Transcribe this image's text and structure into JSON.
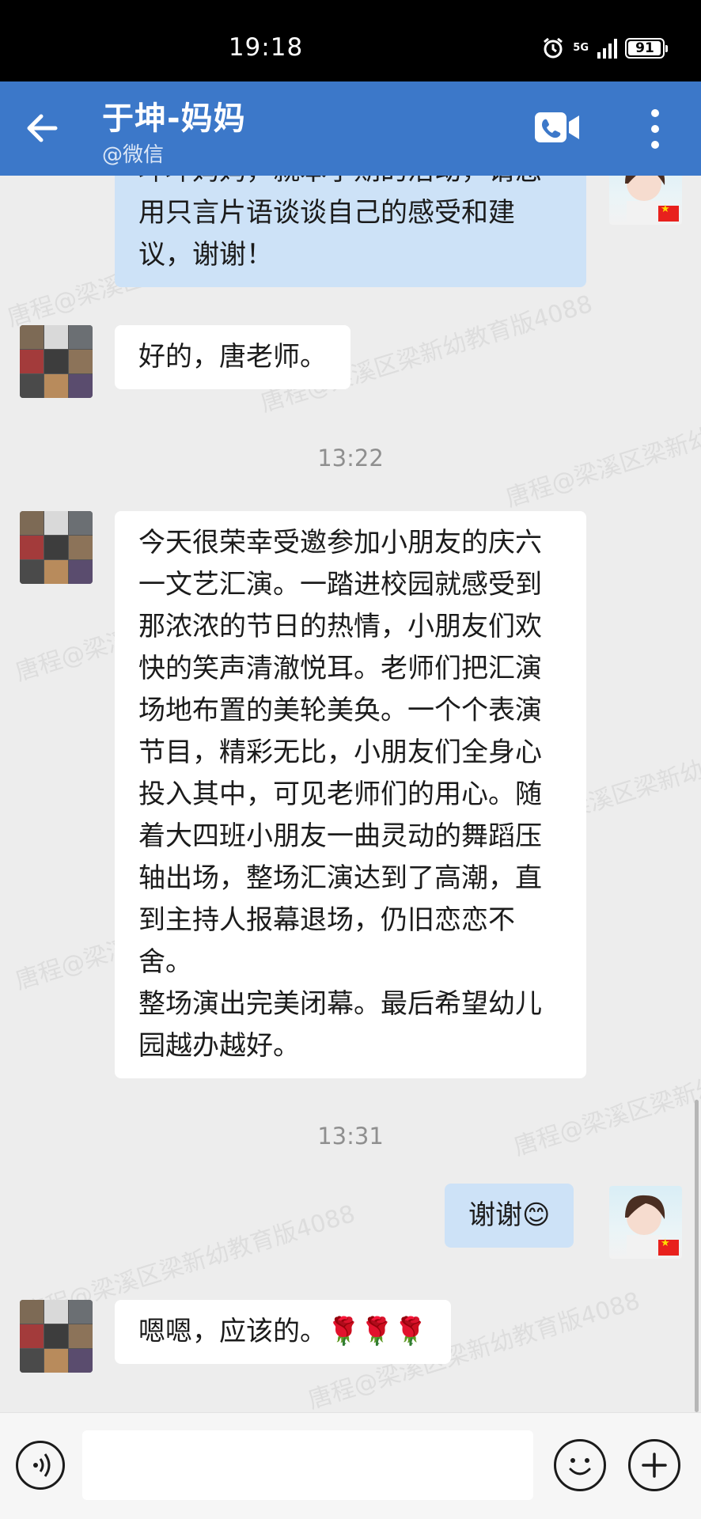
{
  "status_bar": {
    "time": "19:18",
    "network": "5G",
    "battery": "91"
  },
  "header": {
    "title": "于坤-妈妈",
    "subtitle": "@微信"
  },
  "watermark_text": "唐程@梁溪区梁新幼教育版4088",
  "messages": [
    {
      "sender": "self",
      "text": "坤坤妈妈，就本学期的活动，请您用只言片语谈谈自己的感受和建议，谢谢！"
    },
    {
      "sender": "other",
      "text": "好的，唐老师。"
    },
    {
      "type": "time",
      "text": "13:22"
    },
    {
      "sender": "other",
      "text": "今天很荣幸受邀参加小朋友的庆六一文艺汇演。一踏进校园就感受到那浓浓的节日的热情，小朋友们欢快的笑声清澈悦耳。老师们把汇演场地布置的美轮美奂。一个个表演节目，精彩无比，小朋友们全身心投入其中，可见老师们的用心。随着大四班小朋友一曲灵动的舞蹈压轴出场，整场汇演达到了高潮，直到主持人报幕退场，仍旧恋恋不舍。\n整场演出完美闭幕。最后希望幼儿园越办越好。"
    },
    {
      "type": "time",
      "text": "13:31"
    },
    {
      "sender": "self",
      "text": "谢谢😊"
    },
    {
      "sender": "other",
      "text": "嗯嗯，应该的。🌹🌹🌹"
    }
  ],
  "icons": {
    "back": "arrow-left-icon",
    "video_call": "video-call-icon",
    "more": "more-vertical-icon",
    "voice": "voice-icon",
    "emoji": "emoji-icon",
    "plus": "plus-icon"
  },
  "colors": {
    "header": "#3c78c9",
    "self_bubble": "#cde2f7",
    "other_bubble": "#ffffff",
    "background": "#ededed"
  }
}
